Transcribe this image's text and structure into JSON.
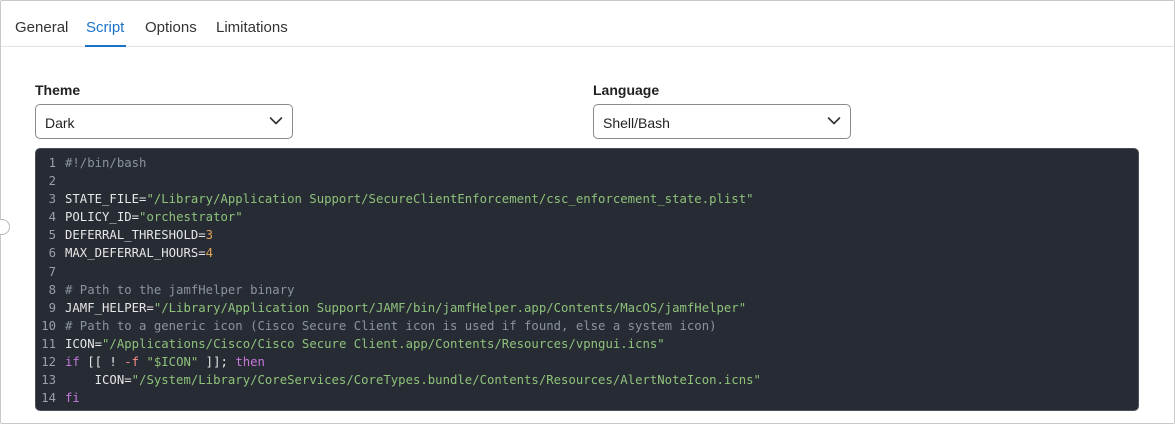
{
  "tabs": [
    {
      "label": "General",
      "active": false
    },
    {
      "label": "Script",
      "active": true
    },
    {
      "label": "Options",
      "active": false
    },
    {
      "label": "Limitations",
      "active": false
    }
  ],
  "theme": {
    "label": "Theme",
    "value": "Dark"
  },
  "language": {
    "label": "Language",
    "value": "Shell/Bash"
  },
  "colors": {
    "accent": "#1a73c8",
    "editor_bg": "#272b33",
    "string": "#8ec27b",
    "number": "#e2a55a",
    "keyword": "#c678dd",
    "comment": "#8b939c"
  },
  "code_lines": [
    {
      "n": "1",
      "tokens": [
        {
          "t": "#!/bin/bash",
          "c": "c"
        }
      ]
    },
    {
      "n": "2",
      "tokens": []
    },
    {
      "n": "3",
      "tokens": [
        {
          "t": "STATE_FILE=",
          "c": "tx"
        },
        {
          "t": "\"/Library/Application Support/SecureClientEnforcement/csc_enforcement_state.plist\"",
          "c": "s"
        }
      ]
    },
    {
      "n": "4",
      "tokens": [
        {
          "t": "POLICY_ID=",
          "c": "tx"
        },
        {
          "t": "\"orchestrator\"",
          "c": "s"
        }
      ]
    },
    {
      "n": "5",
      "tokens": [
        {
          "t": "DEFERRAL_THRESHOLD=",
          "c": "tx"
        },
        {
          "t": "3",
          "c": "n"
        }
      ]
    },
    {
      "n": "6",
      "tokens": [
        {
          "t": "MAX_DEFERRAL_HOURS=",
          "c": "tx"
        },
        {
          "t": "4",
          "c": "n"
        }
      ]
    },
    {
      "n": "7",
      "tokens": []
    },
    {
      "n": "8",
      "tokens": [
        {
          "t": "# Path to the jamfHelper binary",
          "c": "c"
        }
      ]
    },
    {
      "n": "9",
      "tokens": [
        {
          "t": "JAMF_HELPER=",
          "c": "tx"
        },
        {
          "t": "\"/Library/Application Support/JAMF/bin/jamfHelper.app/Contents/MacOS/jamfHelper\"",
          "c": "s"
        }
      ]
    },
    {
      "n": "10",
      "tokens": [
        {
          "t": "# Path to a generic icon (Cisco Secure Client icon is used if found, else a system icon)",
          "c": "c"
        }
      ]
    },
    {
      "n": "11",
      "tokens": [
        {
          "t": "ICON=",
          "c": "tx"
        },
        {
          "t": "\"/Applications/Cisco/Cisco Secure Client.app/Contents/Resources/vpngui.icns\"",
          "c": "s"
        }
      ]
    },
    {
      "n": "12",
      "tokens": [
        {
          "t": "if",
          "c": "k"
        },
        {
          "t": " [[ ! ",
          "c": "tx"
        },
        {
          "t": "-f",
          "c": "o"
        },
        {
          "t": " ",
          "c": "tx"
        },
        {
          "t": "\"$ICON\"",
          "c": "s"
        },
        {
          "t": " ]]; ",
          "c": "tx"
        },
        {
          "t": "then",
          "c": "k"
        }
      ]
    },
    {
      "n": "13",
      "tokens": [
        {
          "t": "    ICON=",
          "c": "tx"
        },
        {
          "t": "\"/System/Library/CoreServices/CoreTypes.bundle/Contents/Resources/AlertNoteIcon.icns\"",
          "c": "s"
        }
      ]
    },
    {
      "n": "14",
      "tokens": [
        {
          "t": "fi",
          "c": "k"
        }
      ]
    }
  ]
}
